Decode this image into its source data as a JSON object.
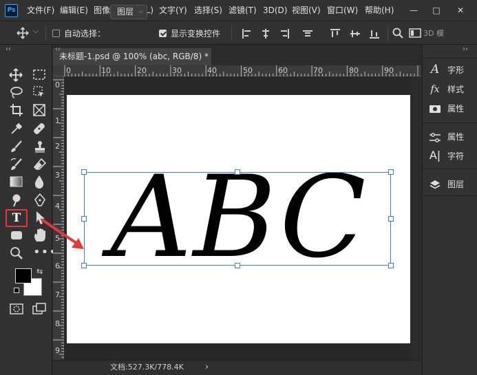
{
  "menu_bar": {
    "app_logo": "Ps",
    "items": [
      "文件(F)",
      "编辑(E)",
      "图像(I)",
      "图层(L)",
      "文字(Y)",
      "选择(S)",
      "滤镜(T)",
      "3D(D)",
      "视图(V)",
      "窗口(W)",
      "帮助(H)"
    ],
    "window_buttons": [
      "—",
      "□",
      "✕"
    ]
  },
  "options_bar": {
    "auto_select_label": "自动选择：",
    "auto_select_checked": false,
    "layer_dropdown_value": "图层",
    "show_transform_label": "显示变换控件",
    "show_transform_checked": true,
    "mode_3d_label": "3D 模"
  },
  "document": {
    "tab_title": "未标题-1.psd @ 100% (abc, RGB/8) *",
    "ruler_top_labels": [
      "0",
      "10",
      "20",
      "30",
      "40",
      "50",
      "60",
      "70",
      "80",
      "90"
    ],
    "ruler_left_labels": [
      "0",
      "1",
      "2",
      "3",
      "4",
      "5",
      "6",
      "7",
      "8",
      "9"
    ],
    "canvas_text": "ABC",
    "status_text": "文档:527.3K/778.4K",
    "status_arrow": "›"
  },
  "tools": {
    "type_tool_glyph": "T",
    "highlighted_tool": "type-tool",
    "highlight_color": "#e03a3a"
  },
  "right_panel": {
    "items": [
      {
        "icon": "character-icon",
        "label": "字形"
      },
      {
        "icon": "fx-icon",
        "label": "样式"
      },
      {
        "icon": "camera-icon",
        "label": "属性"
      },
      {
        "icon": "sliders-icon",
        "label": "属性"
      },
      {
        "icon": "text-cursor-icon",
        "label": "字符"
      },
      {
        "icon": "layers-icon",
        "label": "图层"
      }
    ]
  },
  "colors": {
    "accent_arrow": "#e53935",
    "selection_frame": "#3d7bd9"
  }
}
